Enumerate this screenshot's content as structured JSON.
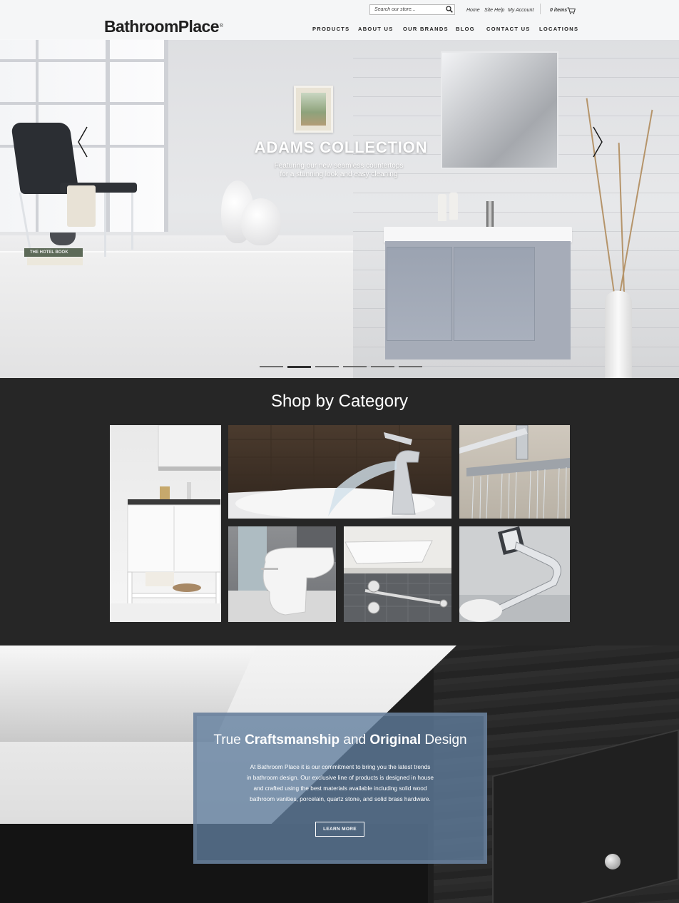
{
  "header": {
    "logo": "BathroomPlace",
    "logo_mark": "®",
    "search_placeholder": "Search our store...",
    "util_links": [
      "Home",
      "Site Help",
      "My Account"
    ],
    "cart_label": "0 items",
    "nav": [
      "PRODUCTS",
      "ABOUT US",
      "OUR BRANDS",
      "BLOG",
      "CONTACT US",
      "LOCATIONS"
    ]
  },
  "hero": {
    "title": "ADAMS COLLECTION",
    "subtitle_line1": "Featuring our new seamless countertops",
    "subtitle_line2": "for a stunning look and easy cleaning",
    "book_label": "THE HOTEL BOOK",
    "slide_count": 6,
    "active_slide": 2
  },
  "category": {
    "title": "Shop by Category",
    "tiles": [
      "vanity",
      "faucet",
      "shower-head",
      "toilet",
      "vessel-sink",
      "towel-bar"
    ]
  },
  "craft": {
    "title_part1": "True ",
    "title_part2": "Craftsmanship",
    "title_part3": " and ",
    "title_part4": "Original",
    "title_part5": " Design",
    "text_line1": "At Bathroom Place it is our commitment to bring you the latest trends",
    "text_line2": "in bathroom design. Our exclusive line of products is designed in house",
    "text_line3": "and crafted using the best materials available including solid wood",
    "text_line4": "bathroom vanities, porcelain, quartz stone, and solid brass hardware.",
    "button": "LEARN MORE"
  },
  "colors": {
    "dark_bg": "#262626",
    "overlay_blue": "#607e9e",
    "cabinet_gray": "#a6acb8"
  }
}
